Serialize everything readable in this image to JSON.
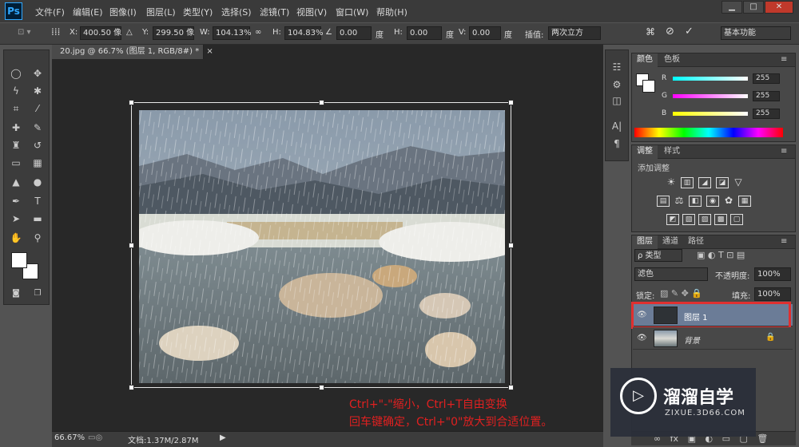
{
  "app": {
    "logo": "Ps"
  },
  "menu": [
    "文件(F)",
    "编辑(E)",
    "图像(I)",
    "图层(L)",
    "类型(Y)",
    "选择(S)",
    "滤镜(T)",
    "视图(V)",
    "窗口(W)",
    "帮助(H)"
  ],
  "window_controls": {
    "minimize": "▁",
    "maximize": "□",
    "close": "✕"
  },
  "options": {
    "x_label": "X:",
    "x_value": "400.50 像",
    "y_label": "Y:",
    "y_value": "299.50 像",
    "w_label": "W:",
    "w_value": "104.13%",
    "h_label": "H:",
    "h_value": "104.83%",
    "angle_value": "0.00",
    "angle_unit": "度",
    "hskew_label": "H:",
    "hskew_value": "0.00",
    "hskew_unit": "度",
    "vskew_label": "V:",
    "vskew_value": "0.00",
    "vskew_unit": "度",
    "interp_label": "插值:",
    "interp_value": "两次立方",
    "workspace": "基本功能"
  },
  "document": {
    "tab_title": "20.jpg @ 66.7% (图层 1, RGB/8#) *",
    "tab_close": "×"
  },
  "status": {
    "zoom": "66.67%",
    "doc_info": "文档:1.37M/2.87M"
  },
  "color_panel": {
    "tabs": [
      "颜色",
      "色板"
    ],
    "channels": [
      {
        "label": "R",
        "value": "255",
        "color": "#00ffff"
      },
      {
        "label": "G",
        "value": "255",
        "color": "#ff00ff"
      },
      {
        "label": "B",
        "value": "255",
        "color": "#ffff00"
      }
    ]
  },
  "adjust_panel": {
    "tabs": [
      "调整",
      "样式"
    ],
    "title": "添加调整"
  },
  "layers_panel": {
    "tabs": [
      "图层",
      "通道",
      "路径"
    ],
    "filter": "ρ 类型",
    "blend_mode": "滤色",
    "opacity_label": "不透明度:",
    "opacity_value": "100%",
    "lock_label": "锁定:",
    "fill_label": "填充:",
    "fill_value": "100%",
    "layers": [
      {
        "name": "图层 1",
        "selected": true
      },
      {
        "name": "背景",
        "selected": false
      }
    ]
  },
  "caption": {
    "line1": "Ctrl+\"-\"缩小，Ctrl+T自由变换",
    "line2": "回车键确定，Ctrl+\"0\"放大到合适位置。"
  },
  "watermark": {
    "title": "溜溜自学",
    "url": "ZIXUE.3D66.COM"
  },
  "colors": {
    "accent_red": "#e02020",
    "selected_layer": "#6b7c97",
    "panel_bg": "#484848"
  }
}
